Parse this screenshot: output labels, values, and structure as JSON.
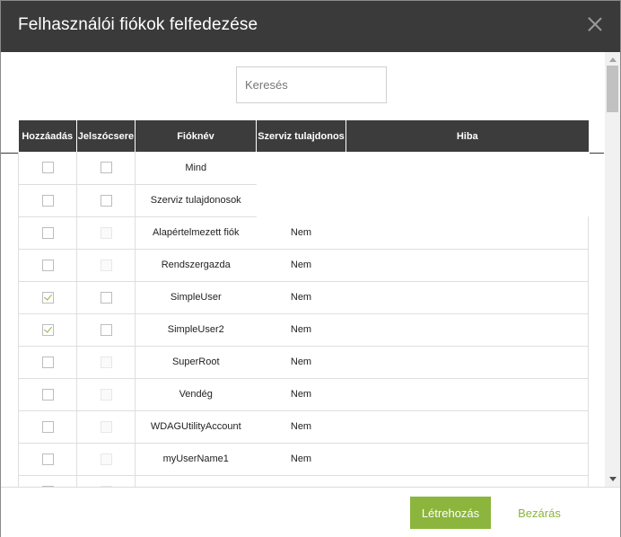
{
  "dialog": {
    "title": "Felhasználói fiókok felfedezése",
    "close_icon": "close-icon"
  },
  "search": {
    "placeholder": "Keresés",
    "value": ""
  },
  "table": {
    "headers": [
      "Hozzáadás",
      "Jelszócsere",
      "Fióknév",
      "Szerviz tulajdonos",
      "Hiba"
    ],
    "rows": [
      {
        "add": false,
        "add_disabled": false,
        "pwd": false,
        "pwd_disabled": false,
        "name": "Mind",
        "owner": "",
        "error": "",
        "short": true
      },
      {
        "add": false,
        "add_disabled": false,
        "pwd": false,
        "pwd_disabled": false,
        "name": "Szerviz tulajdonosok",
        "owner": "",
        "error": "",
        "short": true
      },
      {
        "add": false,
        "add_disabled": false,
        "pwd": false,
        "pwd_disabled": true,
        "name": "Alapértelmezett fiók",
        "owner": "Nem",
        "error": "",
        "short": false
      },
      {
        "add": false,
        "add_disabled": false,
        "pwd": false,
        "pwd_disabled": true,
        "name": "Rendszergazda",
        "owner": "Nem",
        "error": "",
        "short": false
      },
      {
        "add": true,
        "add_disabled": false,
        "pwd": false,
        "pwd_disabled": false,
        "name": "SimpleUser",
        "owner": "Nem",
        "error": "",
        "short": false
      },
      {
        "add": true,
        "add_disabled": false,
        "pwd": false,
        "pwd_disabled": false,
        "name": "SimpleUser2",
        "owner": "Nem",
        "error": "",
        "short": false
      },
      {
        "add": false,
        "add_disabled": false,
        "pwd": false,
        "pwd_disabled": true,
        "name": "SuperRoot",
        "owner": "Nem",
        "error": "",
        "short": false
      },
      {
        "add": false,
        "add_disabled": false,
        "pwd": false,
        "pwd_disabled": true,
        "name": "Vendég",
        "owner": "Nem",
        "error": "",
        "short": false
      },
      {
        "add": false,
        "add_disabled": false,
        "pwd": false,
        "pwd_disabled": true,
        "name": "WDAGUtilityAccount",
        "owner": "Nem",
        "error": "",
        "short": false
      },
      {
        "add": false,
        "add_disabled": false,
        "pwd": false,
        "pwd_disabled": true,
        "name": "myUserName1",
        "owner": "Nem",
        "error": "",
        "short": false
      },
      {
        "add": false,
        "add_disabled": false,
        "pwd": false,
        "pwd_disabled": true,
        "name": "",
        "owner": "",
        "error": "",
        "short": false
      }
    ]
  },
  "footer": {
    "create_label": "Létrehozás",
    "close_label": "Bezárás"
  },
  "colors": {
    "header_bg": "#3a3a3a",
    "accent": "#8bb53d",
    "table_header_bg": "#3c3c3c"
  }
}
